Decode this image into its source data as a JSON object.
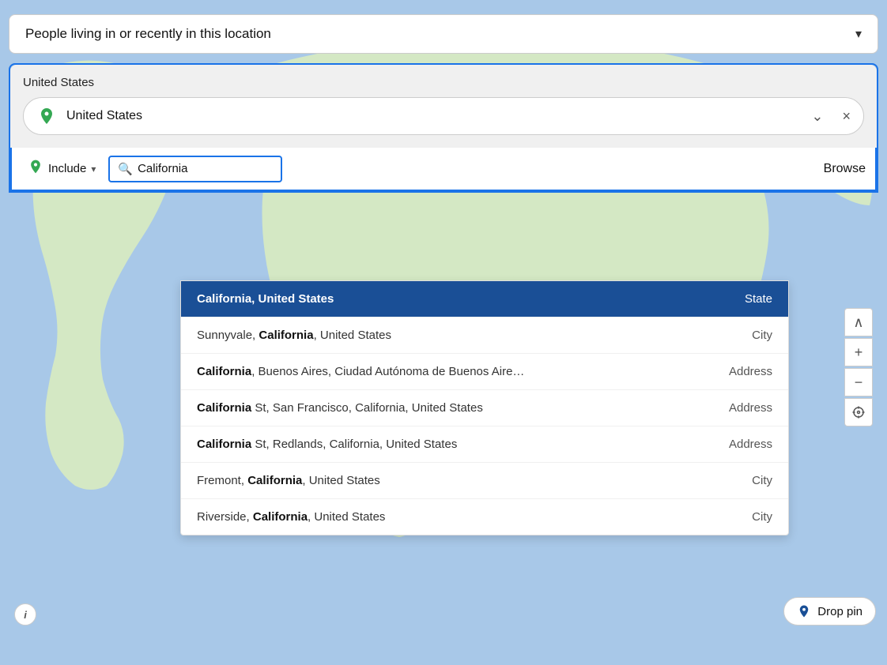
{
  "header": {
    "location_type_label": "People living in or recently in this location",
    "chevron": "▾"
  },
  "country_section": {
    "title": "United States",
    "country_name": "United States",
    "chevron": "⌄",
    "close": "×"
  },
  "search_bar": {
    "include_label": "Include",
    "include_chevron": "▾",
    "search_value": "California",
    "browse_label": "Browse"
  },
  "results": [
    {
      "id": 1,
      "text_prefix": "",
      "text_bold": "California, United States",
      "text_suffix": "",
      "type": "State",
      "selected": true
    },
    {
      "id": 2,
      "text_prefix": "Sunnyvale, ",
      "text_bold": "California",
      "text_suffix": ", United States",
      "type": "City",
      "selected": false
    },
    {
      "id": 3,
      "text_prefix": "",
      "text_bold": "California",
      "text_suffix": ", Buenos Aires, Ciudad Autónoma de Buenos Aire…",
      "type": "Address",
      "selected": false
    },
    {
      "id": 4,
      "text_prefix": "",
      "text_bold": "California",
      "text_suffix": " St, San Francisco, California, United States",
      "type": "Address",
      "selected": false
    },
    {
      "id": 5,
      "text_prefix": "",
      "text_bold": "California",
      "text_suffix": " St, Redlands, California, United States",
      "type": "Address",
      "selected": false
    },
    {
      "id": 6,
      "text_prefix": "Fremont, ",
      "text_bold": "California",
      "text_suffix": ", United States",
      "type": "City",
      "selected": false
    },
    {
      "id": 7,
      "text_prefix": "Riverside, ",
      "text_bold": "California",
      "text_suffix": ", United States",
      "type": "City",
      "selected": false
    }
  ],
  "map_controls": {
    "chevron_up": "∧",
    "plus": "+",
    "minus": "−",
    "target": "⊙"
  },
  "drop_pin": {
    "label": "Drop pin",
    "icon": "♥"
  },
  "info_btn": "i"
}
